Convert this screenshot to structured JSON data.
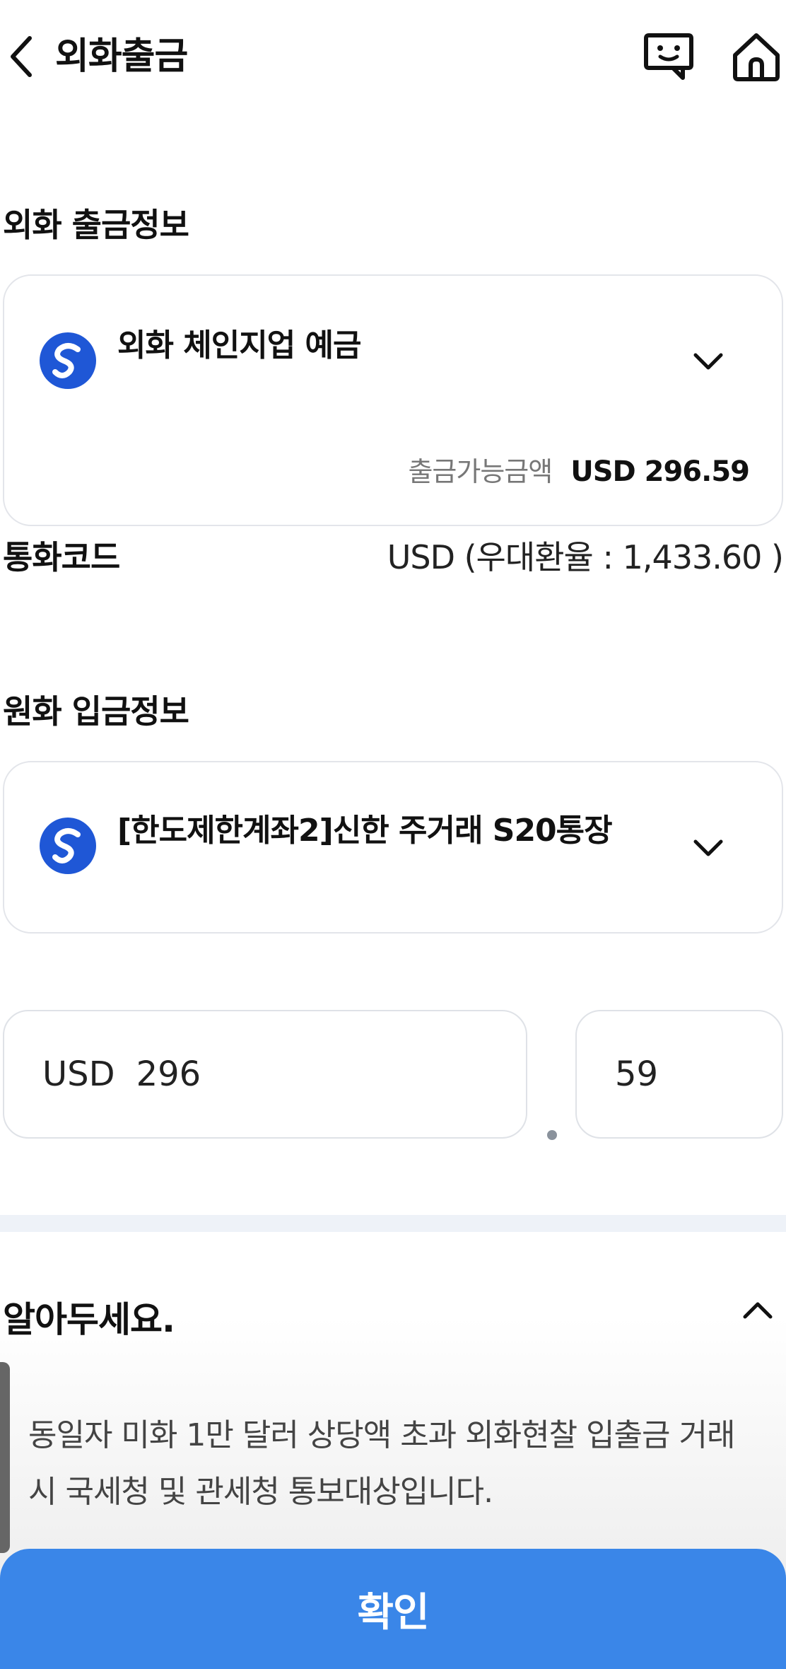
{
  "header": {
    "title": "외화출금",
    "chat_icon": "chatbot-icon",
    "home_icon": "home-icon",
    "back_icon": "chevron-left-icon"
  },
  "withdraw_section": {
    "title": "외화 출금정보",
    "account_name": "외화 체인지업 예금",
    "available_label": "출금가능금액",
    "available_value": "USD 296.59"
  },
  "currency": {
    "label": "통화코드",
    "value": "USD (우대환율 : 1,433.60 )"
  },
  "deposit_section": {
    "title": "원화 입금정보",
    "account_name": "[한도제한계좌2]신한 주거래 S20통장"
  },
  "amount": {
    "currency": "USD",
    "integer": "296",
    "decimal": "59"
  },
  "notice": {
    "title": "알아두세요.",
    "text": "동일자 미화 1만 달러 상당액 초과 외화현찰 입출금 거래 시 국세청 및 관세청 통보대상입니다."
  },
  "confirm_label": "확인",
  "colors": {
    "brand_blue": "#1f57d6",
    "confirm_button": "#3a86e8"
  }
}
